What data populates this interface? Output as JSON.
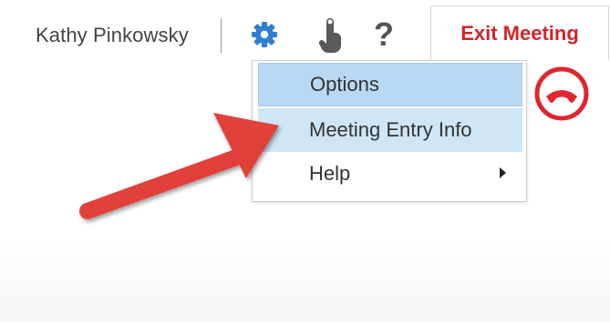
{
  "header": {
    "user_name": "Kathy Pinkowsky",
    "exit_label": "Exit Meeting",
    "help_glyph": "?"
  },
  "icons": {
    "settings": "gear-icon",
    "presenter": "touch-hand-icon",
    "help": "question-mark-icon",
    "hangup": "hang-up-phone-icon",
    "annotation": "red-arrow-annotation"
  },
  "menu": {
    "items": [
      {
        "label": "Options",
        "state": "highlighted"
      },
      {
        "label": "Meeting Entry Info",
        "state": "hover"
      },
      {
        "label": "Help",
        "has_submenu": true
      }
    ]
  },
  "colors": {
    "accent_blue": "#2f7fd3",
    "exit_red": "#d3232a",
    "menu_highlight": "#b9d8f1",
    "menu_hover": "#cfe6f7",
    "annotation_red": "#e2413b"
  }
}
